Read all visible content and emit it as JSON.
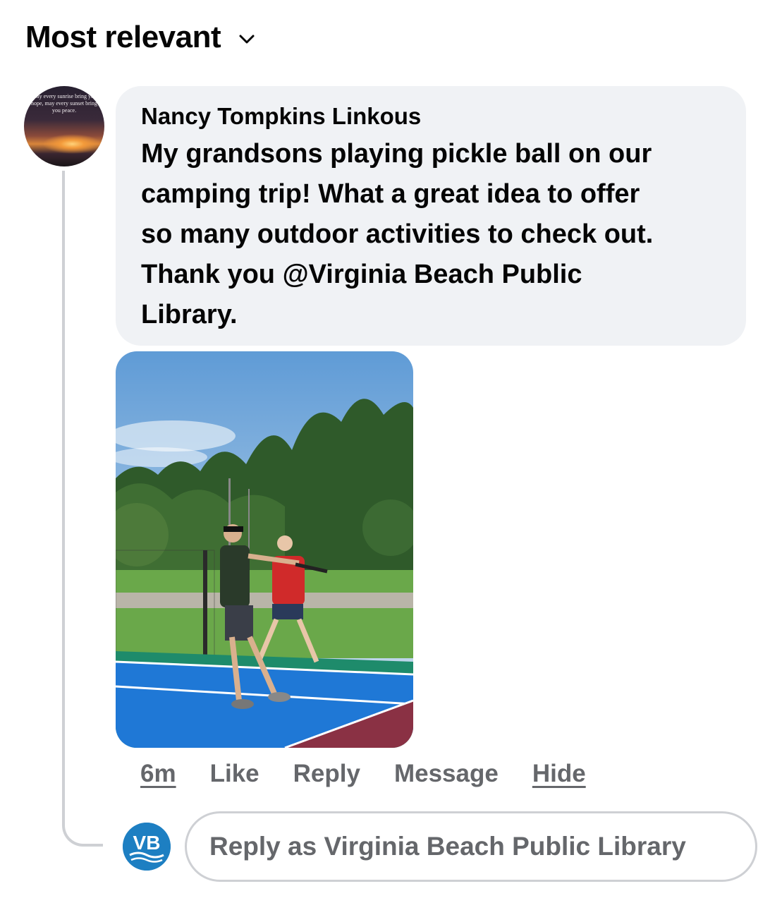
{
  "sort": {
    "label": "Most relevant"
  },
  "comment": {
    "avatar_text": "May every sunrise bring you hope, may every sunset bring you peace.",
    "author": "Nancy Tompkins Linkous",
    "text_lines": [
      "My grandsons playing pickle ball on our",
      "camping trip! What a great idea to offer",
      "so many outdoor activities to check out.",
      "Thank you @Virginia Beach Public",
      "Library."
    ],
    "actions": {
      "time": "6m",
      "like": "Like",
      "reply": "Reply",
      "message": "Message",
      "hide": "Hide"
    }
  },
  "reply_box": {
    "avatar_text": "VB",
    "placeholder": "Reply as Virginia Beach Public Library"
  },
  "colors": {
    "bubble_bg": "#f0f2f5",
    "secondary_text": "#65676b",
    "thread_line": "#ced0d4",
    "vb_blue": "#1d7fc2"
  }
}
